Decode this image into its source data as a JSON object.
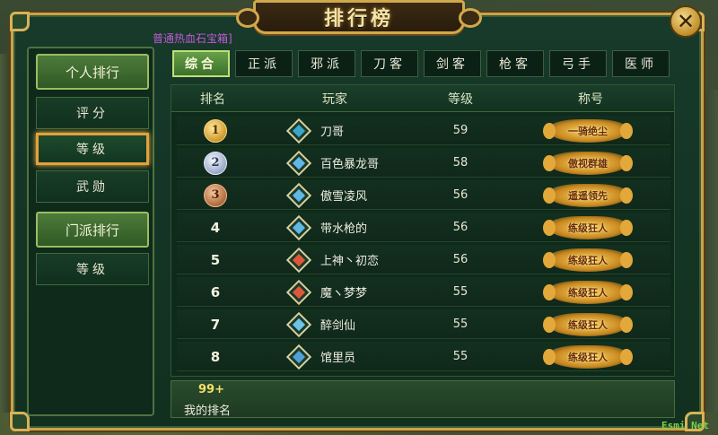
{
  "window": {
    "title": "排行榜",
    "close_label": "✕"
  },
  "notice": "普通热血石宝箱]",
  "sidebar": {
    "personal_header": "个人排行",
    "personal_items": [
      "评分",
      "等级",
      "武勋"
    ],
    "active_item": "等级",
    "faction_header": "门派排行",
    "faction_items": [
      "等级"
    ]
  },
  "tabs": [
    "综合",
    "正派",
    "邪派",
    "刀客",
    "剑客",
    "枪客",
    "弓手",
    "医师"
  ],
  "active_tab": "综合",
  "table": {
    "columns": [
      "排名",
      "玩家",
      "等级",
      "称号"
    ],
    "rows": [
      {
        "rank": "1",
        "medal": "gold",
        "class_icon": "blade-class-icon",
        "class_color": "#3aa7c9",
        "player": "刀哥",
        "level": "59",
        "title": "一骑绝尘"
      },
      {
        "rank": "2",
        "medal": "silver",
        "class_icon": "spear-class-icon",
        "class_color": "#5fb8e6",
        "player": "百色暴龙哥",
        "level": "58",
        "title": "傲视群雄"
      },
      {
        "rank": "3",
        "medal": "bronze",
        "class_icon": "spear-class-icon",
        "class_color": "#5fb8e6",
        "player": "傲雪凌风",
        "level": "56",
        "title": "遥遥领先"
      },
      {
        "rank": "4",
        "medal": "",
        "class_icon": "spear-class-icon",
        "class_color": "#5fb8e6",
        "player": "带水枪的",
        "level": "56",
        "title": "练级狂人"
      },
      {
        "rank": "5",
        "medal": "",
        "class_icon": "fire-class-icon",
        "class_color": "#e0563a",
        "player": "上神丶初恋",
        "level": "56",
        "title": "练级狂人"
      },
      {
        "rank": "6",
        "medal": "",
        "class_icon": "fire-class-icon",
        "class_color": "#e0563a",
        "player": "魔ヽ梦梦",
        "level": "55",
        "title": "练级狂人"
      },
      {
        "rank": "7",
        "medal": "",
        "class_icon": "sword-class-icon",
        "class_color": "#6cc4e8",
        "player": "醉剑仙",
        "level": "55",
        "title": "练级狂人"
      },
      {
        "rank": "8",
        "medal": "",
        "class_icon": "arrow-class-icon",
        "class_color": "#4fa0d8",
        "player": "馆里员",
        "level": "55",
        "title": "练级狂人"
      }
    ]
  },
  "my_rank": {
    "value": "99+",
    "label": "我的排名"
  },
  "watermark": "Esmi Net",
  "colors": {
    "accent_gold": "#c9a44a",
    "panel_green": "#173a2b",
    "active_orange": "#e2a23a"
  }
}
